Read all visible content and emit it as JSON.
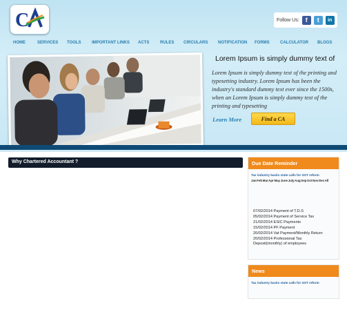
{
  "logo": {
    "text": "CA"
  },
  "social": {
    "label": "Follow Us:",
    "icons": [
      "facebook-icon",
      "twitter-icon",
      "linkedin-icon"
    ],
    "glyphs": [
      "f",
      "t",
      "in"
    ],
    "colors": [
      "#3b5998",
      "#4a9fd6",
      "#0e76a8"
    ]
  },
  "nav": [
    "HOME",
    "SERVICES",
    "TOOLS",
    "IMPORTANT LINKS",
    "ACTS",
    "RULES",
    "CIRCULARS",
    "NOTIFICATION",
    "FORMS",
    "CALCULATOR",
    "BLOGS"
  ],
  "hero": {
    "title": "Lorem Ipsum is simply dummy text of",
    "body": "Lorem Ipsum is simply dummy text of the printing and typesetting industry. Lorem Ipsum has been the industry's standard dummy text ever since the 1500s, when an Lorem Ipsum is simply dummy text of the printing and typesetting",
    "learn_more": "Learn More",
    "find_ca": "Find a CA"
  },
  "main": {
    "title": "Why Chartered Accountant ?"
  },
  "due_date": {
    "title": "Due Date Reminder",
    "link": "Tax industry backs state calls for GST reform",
    "months": "Jan Feb Mar Apr May June July Aug Sep Oct Nov Dec All",
    "items": [
      "07/02/2014 Payment of T.D.S",
      "05/02/2014 Payment of Service Tax",
      "21/02/2014 ESIC Payments",
      "15/02/2014 PF Payment",
      "20/02/2014 Vat Payment/Monthly Return",
      "20/02/2014 Professional Tax",
      "Deposit(monthly) of employees"
    ]
  },
  "news": {
    "title": "News",
    "link": "Tax industry backs state calls for GST reform"
  },
  "colors": {
    "accent_orange": "#f08a1c",
    "nav_blue": "#2a7fb0",
    "dark_bar": "#121c2a",
    "strip_blue": "#0e4a75",
    "button_yellow": "#f3b81a"
  }
}
